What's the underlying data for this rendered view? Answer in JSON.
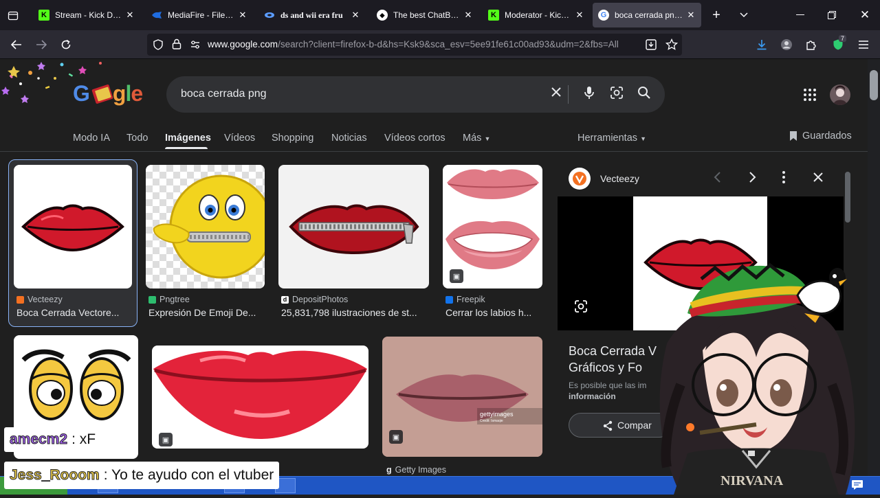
{
  "browser": {
    "tabs": [
      {
        "title": "Stream - Kick Dashb",
        "icon": "kick-icon",
        "active": false
      },
      {
        "title": "MediaFire - File shar",
        "icon": "mediafire-icon",
        "active": false
      },
      {
        "title": "ds and wii era fru",
        "icon": "ds-icon",
        "active": false
      },
      {
        "title": "The best ChatBot ar",
        "icon": "chatbot-icon",
        "active": false
      },
      {
        "title": "Moderator - Kick Da",
        "icon": "kick-icon",
        "active": false
      },
      {
        "title": "boca cerrada png - ",
        "icon": "google-icon",
        "active": true
      }
    ],
    "url_host": "www.google.com",
    "url_rest": "/search?client=firefox-b-d&hs=Ksk9&sca_esv=5ee91fe61c00ad93&udm=2&fbs=All",
    "extensions_badge": "7"
  },
  "google": {
    "logo": "Google",
    "query": "boca cerrada png",
    "tabs": [
      "Modo IA",
      "Todo",
      "Imágenes",
      "Vídeos",
      "Shopping",
      "Noticias",
      "Vídeos cortos",
      "Más"
    ],
    "active_tab": "Imágenes",
    "tools": "Herramientas",
    "saved": "Guardados",
    "results": [
      {
        "source": "Vecteezy",
        "title": "Boca Cerrada Vectore...",
        "color": "#f37021"
      },
      {
        "source": "Pngtree",
        "title": "Expresión De Emoji De...",
        "color": "#2dbd6e"
      },
      {
        "source": "DepositPhotos",
        "title": "25,831,798 ilustraciones de st...",
        "color": "#ffffff"
      },
      {
        "source": "Freepik",
        "title": "Cerrar los labios h...",
        "color": "#1273eb"
      }
    ],
    "row2_source": "Getty Images",
    "getty_watermark": "gettyimages",
    "getty_credit": "Credit: Ismaqie",
    "panel": {
      "source": "Vecteezy",
      "title_line1": "Boca Cerrada V",
      "title_line2": "Gráficos y Fo",
      "notice": "Es posible que las im",
      "info": "información",
      "share": "Compar"
    }
  },
  "overlay": {
    "chat1_user": "amecm2",
    "chat1_msg": ": xF",
    "chat2_user": "Jess_Rooom",
    "chat2_msg": ": Yo te ayudo con el vtuber",
    "shirt_text": "NIRVANA"
  },
  "colors": {
    "lip_red": "#d0192b",
    "lip_dark": "#5a0c12",
    "google_bg": "#1f1f1f",
    "taskbar": "#1f56c4"
  }
}
